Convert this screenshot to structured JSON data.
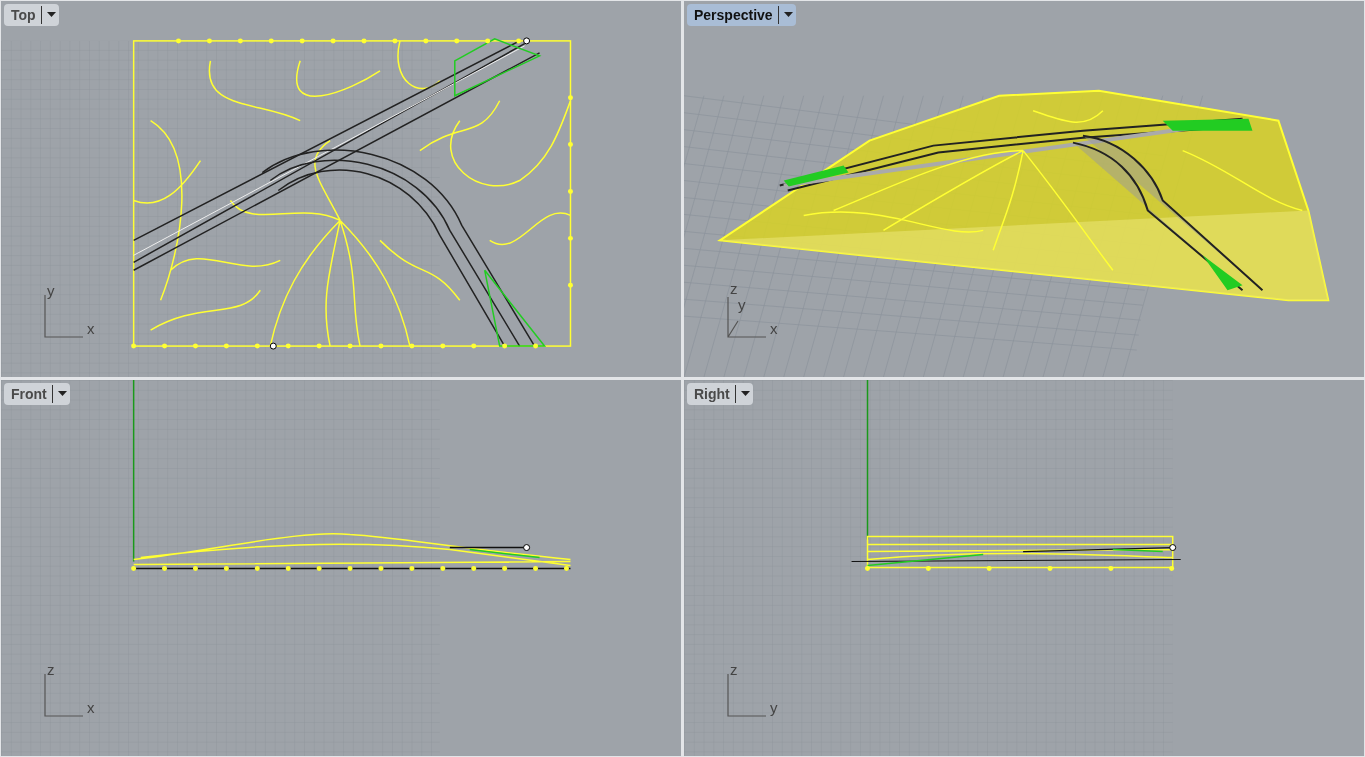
{
  "viewports": [
    {
      "title": "Top",
      "selected": false,
      "kind": "top",
      "axes": [
        "y",
        "x"
      ]
    },
    {
      "title": "Perspective",
      "selected": true,
      "kind": "perspective",
      "axes": [
        "z",
        "y",
        "x"
      ]
    },
    {
      "title": "Front",
      "selected": false,
      "kind": "front",
      "axes": [
        "z",
        "x"
      ]
    },
    {
      "title": "Right",
      "selected": false,
      "kind": "right",
      "axes": [
        "z",
        "y"
      ]
    }
  ]
}
